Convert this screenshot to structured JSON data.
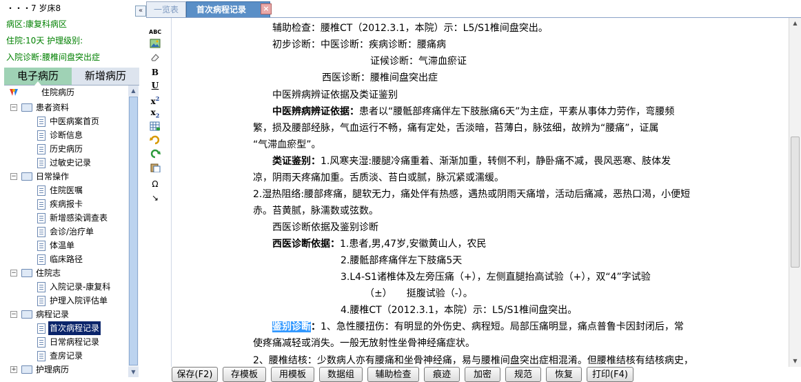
{
  "patient": {
    "header": "\u0011&···7 岁床8",
    "header_display": "・・・7 岁床8",
    "ward": "病区:康复科病区",
    "stay": "住院:10天  护理级别:",
    "admit_diag": "入院诊断:腰椎间盘突出症"
  },
  "left_tabs": [
    "电子病历",
    "新增病历"
  ],
  "tree": {
    "root": "住院病历",
    "groups": [
      {
        "label": "患者资料",
        "items": [
          "中医病案首页",
          "诊断信息",
          "历史病历",
          "过敏史记录"
        ]
      },
      {
        "label": "日常操作",
        "items": [
          "住院医嘱",
          "疾病报卡",
          "新增感染调查表",
          "会诊/治疗单",
          "体温单",
          "临床路径"
        ]
      },
      {
        "label": "住院志",
        "items": [
          "入院记录-康复科",
          "护理入院评估单"
        ]
      },
      {
        "label": "病程记录",
        "items": [
          "首次病程记录",
          "日常病程记录",
          "查房记录"
        ]
      },
      {
        "label": "护理病历",
        "items": []
      }
    ],
    "selected": "首次病程记录"
  },
  "doc_tabs": [
    "一览表",
    "首次病程记录"
  ],
  "editor": {
    "l1": "辅助检查：腰椎CT（2012.3.1，本院）示：L5/S1椎间盘突出。",
    "l2": "初步诊断：中医诊断：疾病诊断：腰痛病",
    "l3": "证候诊断：气滞血瘀证",
    "l4": "西医诊断：腰椎间盘突出症",
    "h1": "中医辨病辨证依据及类证鉴别",
    "p1_label": "中医辨病辨证依据：",
    "p1_a": "患者以“腰骶部疼痛伴左下肢胀痛6天”为主症，平素从事体力劳作，弯腰频",
    "p1_b": "繁，损及腰部经脉，气血运行不畅，痛有定处，舌淡暗，苔薄白，脉弦细，故辨为“腰痛”，证属",
    "p1_c": "“气滞血瘀型”。",
    "p2_label": "类证鉴别：",
    "p2_a": "1.风寒夹湿:腰腿冷痛重着、渐渐加重，转侧不利，静卧痛不减，畏风恶寒、肢体发",
    "p2_b": "凉，阴雨天疼痛加重。舌质淡、苔白或腻，脉沉紧或濡缓。",
    "p3_a": "2.湿热阻络:腰部疼痛，腿软无力，痛处伴有热感，遇热或阴雨天痛增，活动后痛减，恶热口渴，小便短",
    "p3_b": "赤。苔黄腻，脉濡数或弦数。",
    "h2": "西医诊断依据及鉴别诊断",
    "w_label": "西医诊断依据：",
    "w1": "1.患者,男,47岁,安徽黄山人，农民",
    "w2": "2.腰骶部疼痛伴左下肢痛5天",
    "w3": "3.L4-S1诸椎体及左旁压痛（+），左侧直腿抬高试验（+），双“4”字试验",
    "w3b": "（±）　　挺腹试验（-）。",
    "w4": "4.腰椎CT（2012.3.1，本院）示：L5/S1椎间盘突出。",
    "d_label": "鉴别诊断",
    "d_colon": "：",
    "d1_a": "1、急性腰扭伤：有明显的外伤史、病程短。局部压痛明显，痛点普鲁卡因封闭后，常",
    "d1_b": "使疼痛减轻或消失。一般无放射性坐骨神经痛症状。",
    "d2_a": "2、腰椎结核：少数病人亦有腰痛和坐骨神经痛，易与腰椎间盘突出症相混淆。但腰椎结核有结核病史，"
  },
  "buttons": [
    "保存(F2)",
    "存模板",
    "用模板",
    "数据组",
    "辅助检查",
    "痕迹",
    "加密",
    "规范",
    "恢复",
    "打印(F4)"
  ],
  "toolbar_icons": [
    "spellcheck-icon",
    "insert-image-icon",
    "eraser-icon",
    "bold-icon",
    "underline-icon",
    "superscript-icon",
    "subscript-icon",
    "insert-table-icon",
    "undo-icon",
    "redo-icon",
    "paste-icon",
    "special-char-icon",
    "pointer-icon"
  ],
  "colors": {
    "accent_tab": "#5a8fc7",
    "patient_info": "#008000",
    "selection": "#0a246a",
    "highlight": "#3399ff",
    "left_tab_active": "#9fd2b5"
  }
}
